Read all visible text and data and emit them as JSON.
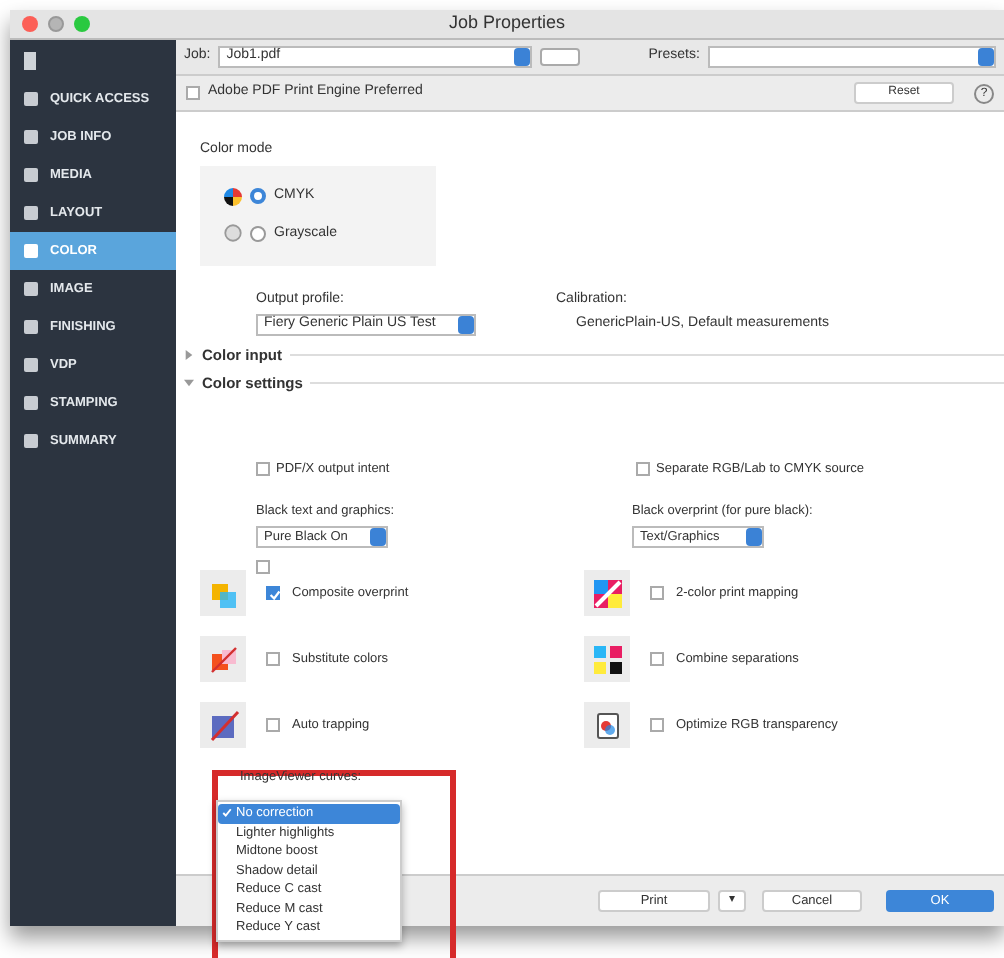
{
  "window": {
    "title": "Job Properties"
  },
  "sidebar": {
    "items": [
      {
        "label": "QUICK ACCESS",
        "selected": false
      },
      {
        "label": "JOB INFO",
        "selected": false
      },
      {
        "label": "MEDIA",
        "selected": false
      },
      {
        "label": "LAYOUT",
        "selected": false
      },
      {
        "label": "COLOR",
        "selected": true
      },
      {
        "label": "IMAGE",
        "selected": false
      },
      {
        "label": "FINISHING",
        "selected": false
      },
      {
        "label": "VDP",
        "selected": false
      },
      {
        "label": "STAMPING",
        "selected": false
      },
      {
        "label": "SUMMARY",
        "selected": false
      }
    ]
  },
  "toolbar": {
    "job_label": "Job:",
    "job_value": "Job1.pdf",
    "presets_label": "Presets:",
    "pdf_engine": {
      "label": "Adobe PDF Print Engine Preferred",
      "checked": false
    },
    "reset": "Reset",
    "help": "?"
  },
  "color_mode": {
    "label": "Color mode",
    "options": [
      {
        "label": "CMYK",
        "selected": true
      },
      {
        "label": "Grayscale",
        "selected": false
      }
    ]
  },
  "output_profile": {
    "label": "Output profile:",
    "value": "Fiery Generic Plain US Test"
  },
  "calibration": {
    "label": "Calibration:",
    "value": "GenericPlain-US, Default measurements"
  },
  "sections": [
    {
      "title": "Color input",
      "expanded": false
    },
    {
      "title": "Color settings",
      "expanded": true
    }
  ],
  "settings": {
    "pdfx": {
      "label": "PDF/X output intent",
      "checked": false
    },
    "separate": {
      "label": "Separate RGB/Lab to CMYK source",
      "checked": false
    },
    "black_text": {
      "label": "Black text and graphics:",
      "value": "Pure Black On"
    },
    "black_overprint": {
      "label": "Black overprint (for pure black):",
      "value": "Text/Graphics",
      "checked": false
    },
    "left": [
      {
        "label": "Composite overprint",
        "checked": true
      },
      {
        "label": "Substitute colors",
        "checked": false
      },
      {
        "label": "Auto trapping",
        "checked": false
      }
    ],
    "right": [
      {
        "label": "2-color print mapping",
        "checked": false
      },
      {
        "label": "Combine separations",
        "checked": false
      },
      {
        "label": "Optimize RGB transparency",
        "checked": false
      }
    ]
  },
  "curves": {
    "label": "ImageViewer curves:",
    "options": [
      {
        "label": "No correction",
        "selected": true
      },
      {
        "label": "Lighter highlights",
        "selected": false
      },
      {
        "label": "Midtone boost",
        "selected": false
      },
      {
        "label": "Shadow detail",
        "selected": false
      },
      {
        "label": "Reduce C cast",
        "selected": false
      },
      {
        "label": "Reduce M cast",
        "selected": false
      },
      {
        "label": "Reduce Y cast",
        "selected": false
      }
    ]
  },
  "buttons": {
    "print": "Print",
    "menu": "▾",
    "cancel": "Cancel",
    "ok": "OK"
  }
}
